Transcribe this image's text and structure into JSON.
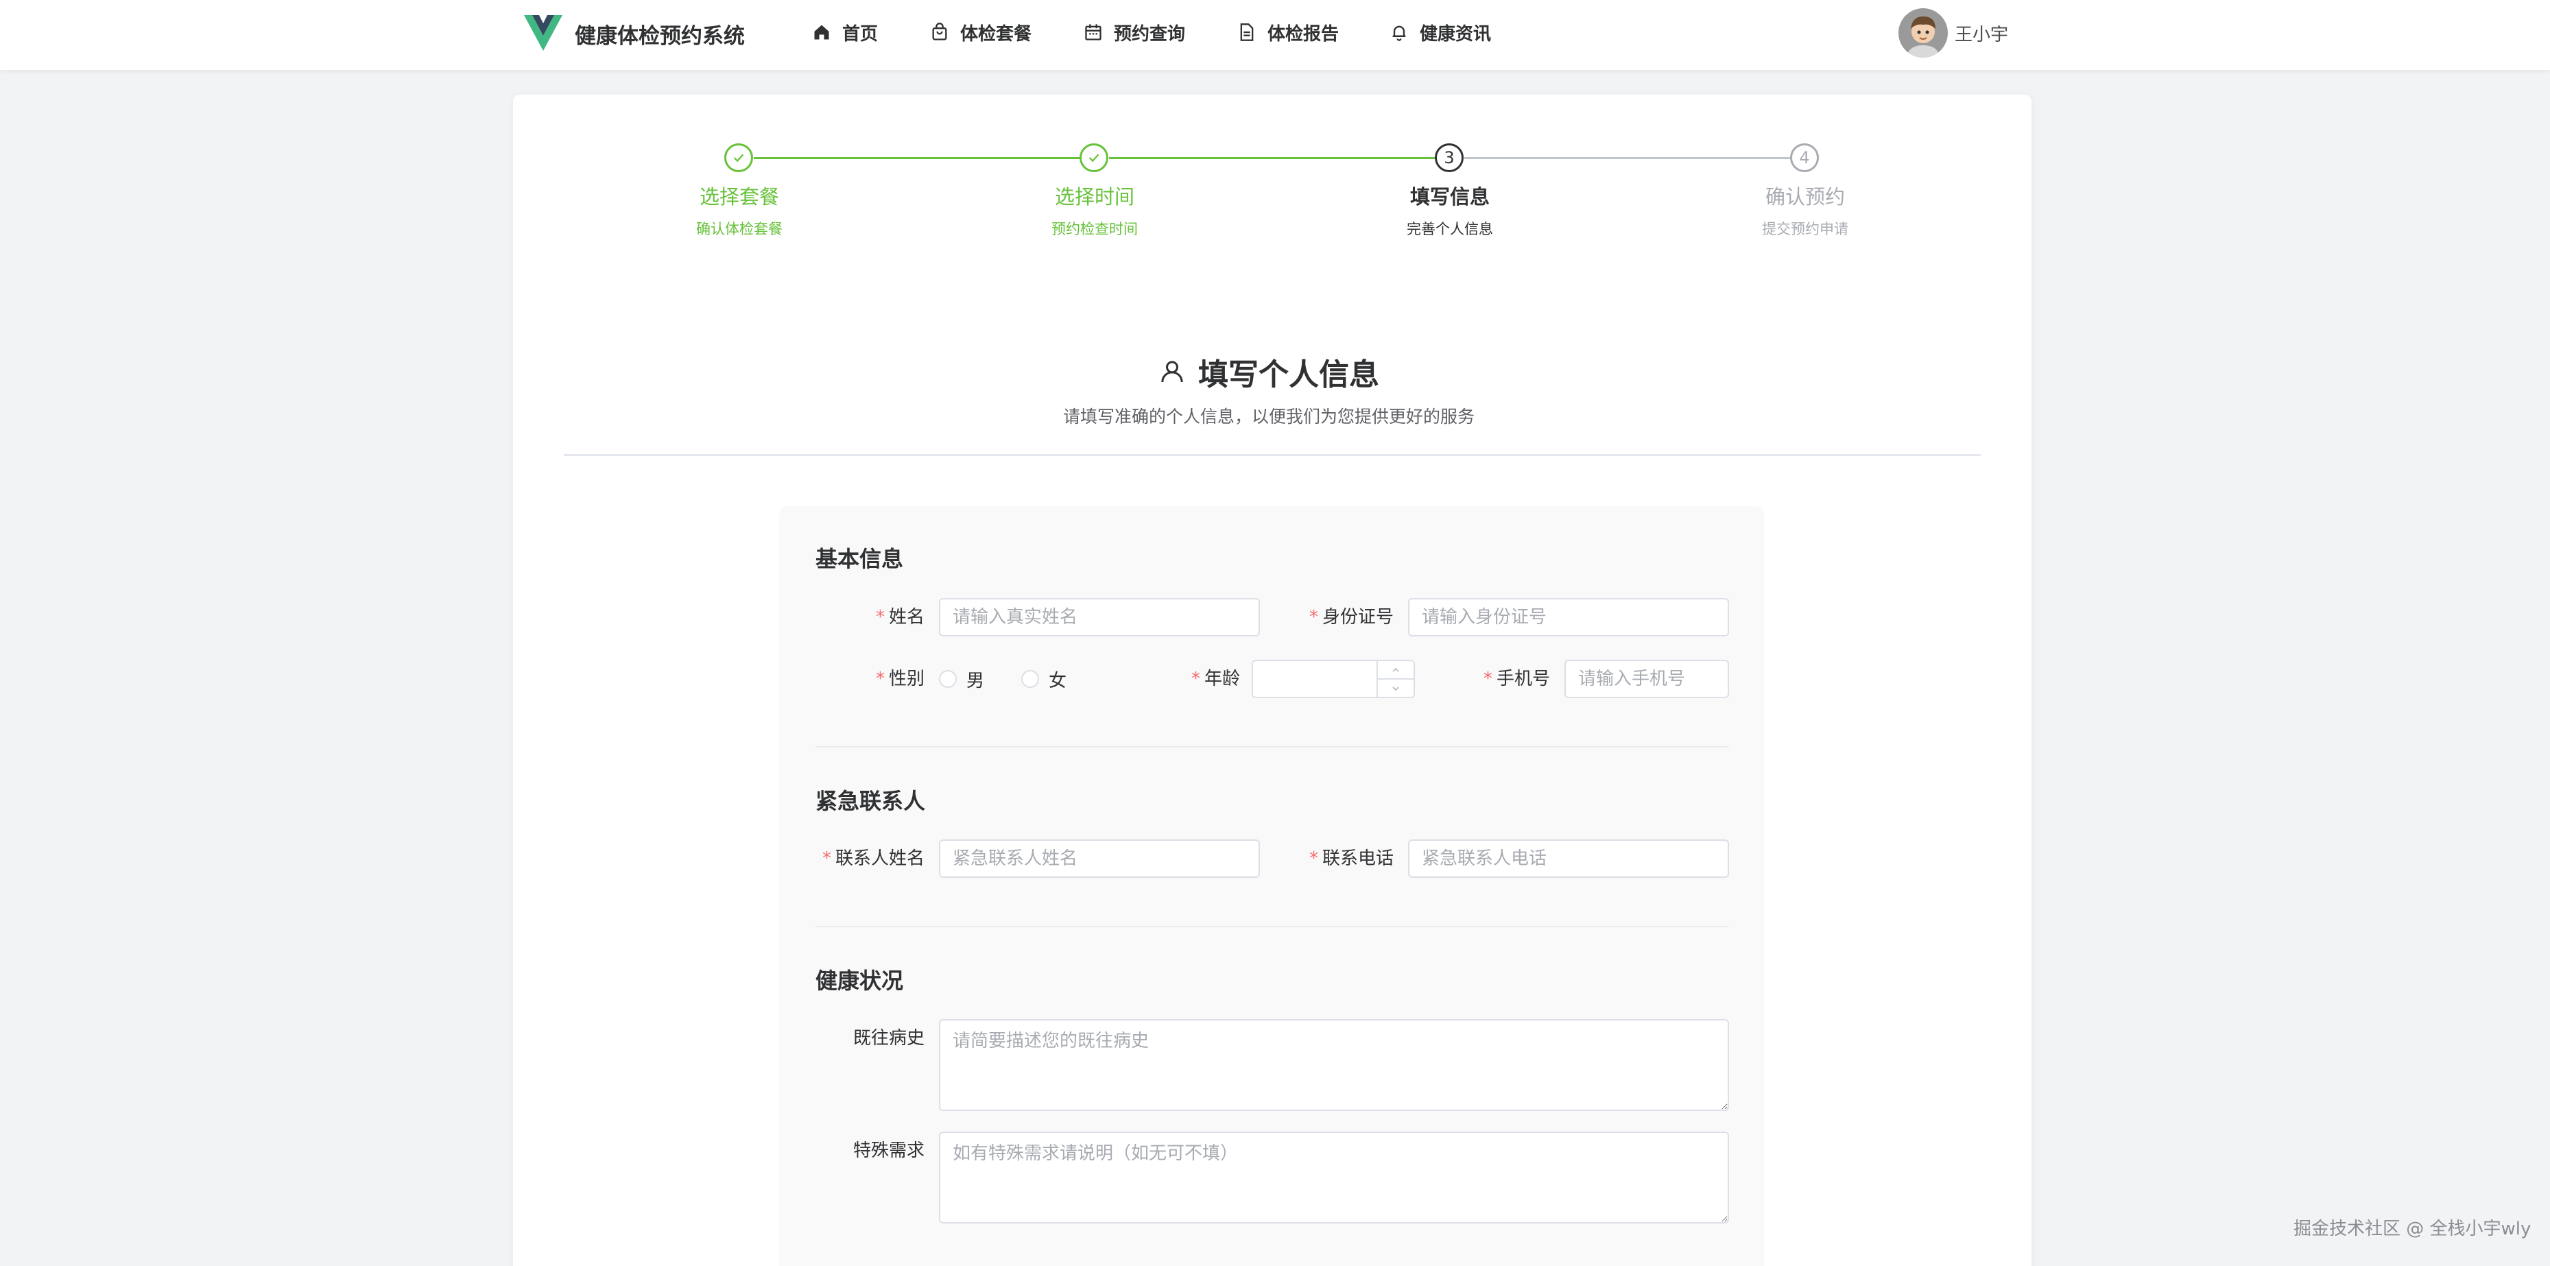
{
  "header": {
    "brand": "健康体检预约系统",
    "nav": [
      {
        "label": "首页",
        "icon": "home-icon"
      },
      {
        "label": "体检套餐",
        "icon": "shopping-bag-icon"
      },
      {
        "label": "预约查询",
        "icon": "calendar-icon"
      },
      {
        "label": "体检报告",
        "icon": "document-icon"
      },
      {
        "label": "健康资讯",
        "icon": "bell-icon"
      }
    ],
    "user": {
      "name": "王小宇"
    }
  },
  "steps": [
    {
      "title": "选择套餐",
      "desc": "确认体检套餐",
      "status": "done"
    },
    {
      "title": "选择时间",
      "desc": "预约检查时间",
      "status": "done"
    },
    {
      "title": "填写信息",
      "desc": "完善个人信息",
      "status": "active",
      "number": "3"
    },
    {
      "title": "确认预约",
      "desc": "提交预约申请",
      "status": "wait",
      "number": "4"
    }
  ],
  "section": {
    "title": "填写个人信息",
    "subtitle": "请填写准确的个人信息，以便我们为您提供更好的服务"
  },
  "form": {
    "basic": {
      "title": "基本信息",
      "name": {
        "label": "姓名",
        "placeholder": "请输入真实姓名",
        "value": ""
      },
      "id_card": {
        "label": "身份证号",
        "placeholder": "请输入身份证号",
        "value": ""
      },
      "gender": {
        "label": "性别",
        "options": [
          "男",
          "女"
        ],
        "selected": null
      },
      "age": {
        "label": "年龄",
        "value": ""
      },
      "phone": {
        "label": "手机号",
        "placeholder": "请输入手机号",
        "value": ""
      }
    },
    "emergency": {
      "title": "紧急联系人",
      "contact_name": {
        "label": "联系人姓名",
        "placeholder": "紧急联系人姓名",
        "value": ""
      },
      "contact_phone": {
        "label": "联系电话",
        "placeholder": "紧急联系人电话",
        "value": ""
      }
    },
    "health": {
      "title": "健康状况",
      "history": {
        "label": "既往病史",
        "placeholder": "请简要描述您的既往病史",
        "value": ""
      },
      "special": {
        "label": "特殊需求",
        "placeholder": "如有特殊需求请说明（如无可不填）",
        "value": ""
      }
    },
    "required_mark": "*"
  },
  "watermark": "掘金技术社区 @ 全栈小宇wly",
  "colors": {
    "success": "#67c23a",
    "required": "#f56c6c",
    "text": "#303133",
    "muted": "#a8abb2",
    "border": "#dcdfe6"
  }
}
